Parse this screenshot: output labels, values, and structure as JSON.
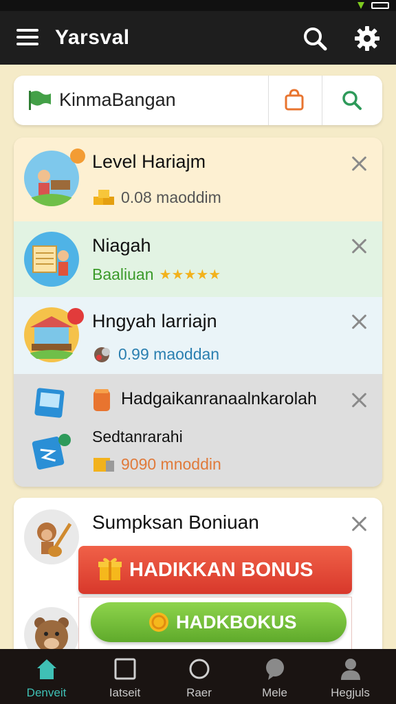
{
  "app": {
    "title": "Yarsval"
  },
  "search": {
    "value": "KinmaBangan"
  },
  "list": [
    {
      "title": "Level Hariajm",
      "subtitle": "0.08 maoddim",
      "subtitle_color": "#555555",
      "bg": "#fdf0d2"
    },
    {
      "title": "Niagah",
      "subtitle": "Baaliuan",
      "subtitle_color": "#3b9a2a",
      "rating": "★★★★★",
      "bg": "#e2f3e3"
    },
    {
      "title": "Hngyah larriajn",
      "subtitle": "0.99 maoddan",
      "subtitle_color": "#2a7fb0",
      "bg": "#eaf4f8"
    },
    {
      "title": "Hadgaikanranaalnkarolah",
      "title2": "Sedtanrarahi",
      "subtitle": "9090 mnoddin",
      "subtitle_color": "#e07a3a",
      "bg": "#dedede"
    }
  ],
  "bonus": {
    "title": "Sumpksan Boniuan",
    "primary_button": "HADIKKAN BONUS",
    "secondary_button": "HADKBOKUS"
  },
  "nav": [
    {
      "label": "Denveit",
      "icon": "home-icon",
      "active": true
    },
    {
      "label": "Iatseit",
      "icon": "square-icon",
      "active": false
    },
    {
      "label": "Raer",
      "icon": "circle-icon",
      "active": false
    },
    {
      "label": "Mele",
      "icon": "chat-icon",
      "active": false
    },
    {
      "label": "Hegjuls",
      "icon": "person-icon",
      "active": false
    }
  ],
  "colors": {
    "appbar": "#1e1e1e",
    "background": "#f5ebc8",
    "accent": "#3fc0b5",
    "red_button": "#e04a36",
    "green_button": "#6fbb36"
  }
}
